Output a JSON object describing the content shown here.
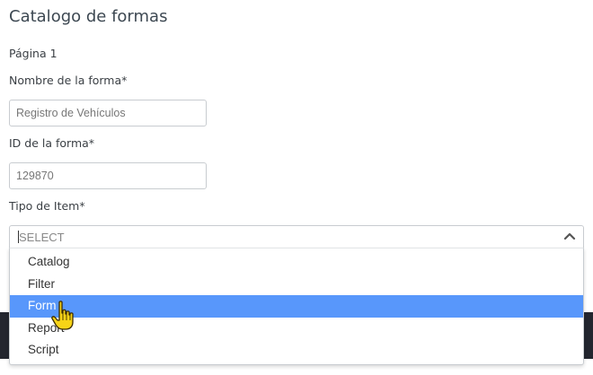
{
  "page": {
    "title": "Catalogo de formas",
    "page_label": "Página 1"
  },
  "form": {
    "name_label": "Nombre de la forma*",
    "name_value": "Registro de Vehículos",
    "id_label": "ID de la forma*",
    "id_value": "129870",
    "type_label": "Tipo de Item*",
    "type_select": {
      "value": "SELECT",
      "options": [
        "Catalog",
        "Filter",
        "Form",
        "Report",
        "Script"
      ],
      "highlighted": "Form"
    }
  },
  "icons": {
    "chevron": "chevron-up-icon",
    "cursor": "hand-pointer-icon"
  },
  "colors": {
    "highlight": "#5897fb",
    "dark_band": "#23262f",
    "cursor_fill": "#f7d417"
  }
}
